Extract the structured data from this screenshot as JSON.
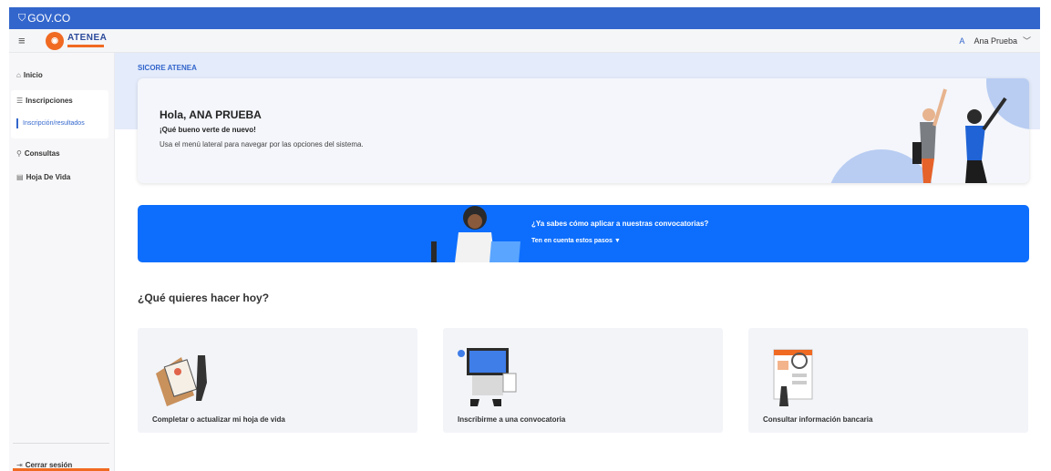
{
  "govbar": {
    "logo": "GOV.CO"
  },
  "header": {
    "brand": "ATENEA",
    "user_initial": "A",
    "user_name": "Ana Prueba"
  },
  "sidebar": {
    "items": [
      {
        "label": "Inicio",
        "icon": "home-icon"
      },
      {
        "label": "Inscripciones",
        "icon": "list-icon"
      },
      {
        "label": "Consultas",
        "icon": "search-icon"
      },
      {
        "label": "Hoja De Vida",
        "icon": "id-card-icon"
      }
    ],
    "subitem": "Inscripción/resultados",
    "logout": "Cerrar sesión"
  },
  "main": {
    "system_title": "SICORE ATENEA",
    "welcome": {
      "hello": "Hola, ANA PRUEBA",
      "subtitle": "¡Qué bueno verte de nuevo!",
      "description": "Usa el menú lateral para navegar por las opciones del sistema."
    },
    "banner": {
      "title": "¿Ya sabes cómo aplicar a nuestras convocatorias?",
      "subtitle": "Ten en cuenta estos pasos ▼"
    },
    "section_title": "¿Qué quieres hacer hoy?",
    "cards": [
      {
        "label": "Completar o actualizar mi hoja de vida"
      },
      {
        "label": "Inscribirme a una convocatoria"
      },
      {
        "label": "Consultar información bancaria"
      }
    ]
  },
  "colors": {
    "primary": "#3366cc",
    "banner": "#0d6efd",
    "accent": "#f06a22"
  }
}
